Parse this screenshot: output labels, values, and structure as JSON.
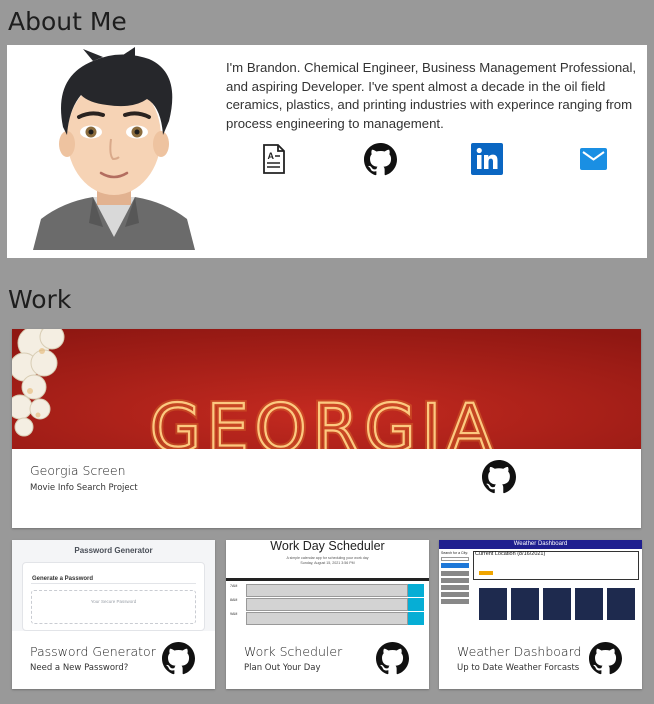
{
  "about": {
    "title": "About Me",
    "bio": "I'm Brandon. Chemical Engineer, Business Management Professional, and aspiring Developer. I've spent almost a decade in the oil field ceramics, plastics, and printing industries with experince ranging from process engineering to management.",
    "links": [
      {
        "icon": "resume-icon",
        "color": "#222222"
      },
      {
        "icon": "github-icon",
        "color": "#111111"
      },
      {
        "icon": "linkedin-icon",
        "color": "#0a66c2"
      },
      {
        "icon": "email-icon",
        "color": "#1a8fe3"
      }
    ]
  },
  "work": {
    "title": "Work",
    "featured": {
      "title": "Georgia Screen",
      "subtitle": "Movie Info Search Project",
      "banner_text": "GEORGIA",
      "banner_color": "#b7221c"
    },
    "projects": [
      {
        "title": "Password Generator",
        "subtitle": "Need a New Password?",
        "thumb": {
          "heading": "Password Generator",
          "card_heading": "Generate a Password",
          "placeholder": "Your Secure Password"
        }
      },
      {
        "title": "Work Scheduler",
        "subtitle": "Plan Out Your Day",
        "thumb": {
          "heading": "Work Day Scheduler",
          "tagline": "A simple calendar app for scheduling your work day",
          "date": "Sunday, August 15, 2021 3:56 PM",
          "hours": [
            "7AM",
            "8AM",
            "9AM"
          ]
        }
      },
      {
        "title": "Weather Dashboard",
        "subtitle": "Up to Date Weather Forcasts",
        "thumb": {
          "heading": "Weather Dashboard",
          "search_label": "Search for a City:",
          "location": "Current Location (8/16/2021)"
        }
      }
    ]
  }
}
